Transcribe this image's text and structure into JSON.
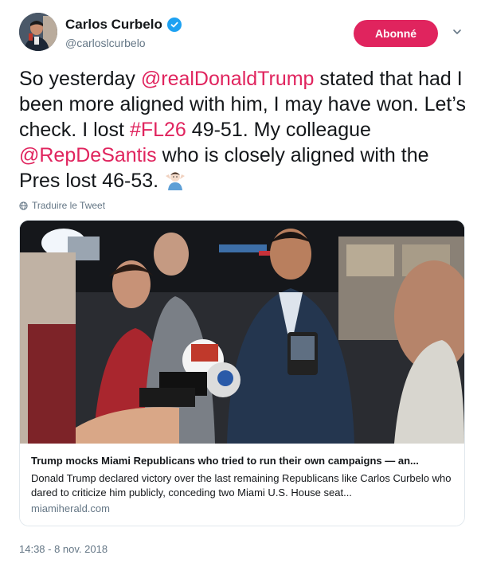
{
  "author": {
    "name": "Carlos Curbelo",
    "handle": "@carloslcurbelo",
    "verified": true
  },
  "follow_button": {
    "label": "Abonné",
    "color": "#e0245e"
  },
  "tweet": {
    "parts": [
      {
        "text": "So yesterday ",
        "type": "text"
      },
      {
        "text": "@realDonaldTrump",
        "type": "mention"
      },
      {
        "text": " stated that had I been more aligned with him, I may have won. Let’s check. I lost ",
        "type": "text"
      },
      {
        "text": "#FL26",
        "type": "mention"
      },
      {
        "text": " 49-51. My colleague ",
        "type": "text"
      },
      {
        "text": "@RepDeSantis",
        "type": "mention"
      },
      {
        "text": " who is closely aligned with the Pres lost 46-53. ",
        "type": "text"
      }
    ],
    "emoji": "man-shrugging-emoji"
  },
  "translate": {
    "label": "Traduire le Tweet",
    "icon": "globe-icon"
  },
  "card": {
    "title": "Trump mocks Miami Republicans who tried to run their own campaigns — an...",
    "description": "Donald Trump declared victory over the last remaining Republicans like Carlos Curbelo who dared to criticize him publicly, conceding two Miami U.S. House seat...",
    "domain": "miamiherald.com",
    "image_desc": "press-photo"
  },
  "timestamp": "14:38 - 8 nov. 2018",
  "colors": {
    "accent": "#e0245e",
    "muted": "#657786",
    "verified": "#1da1f2"
  }
}
